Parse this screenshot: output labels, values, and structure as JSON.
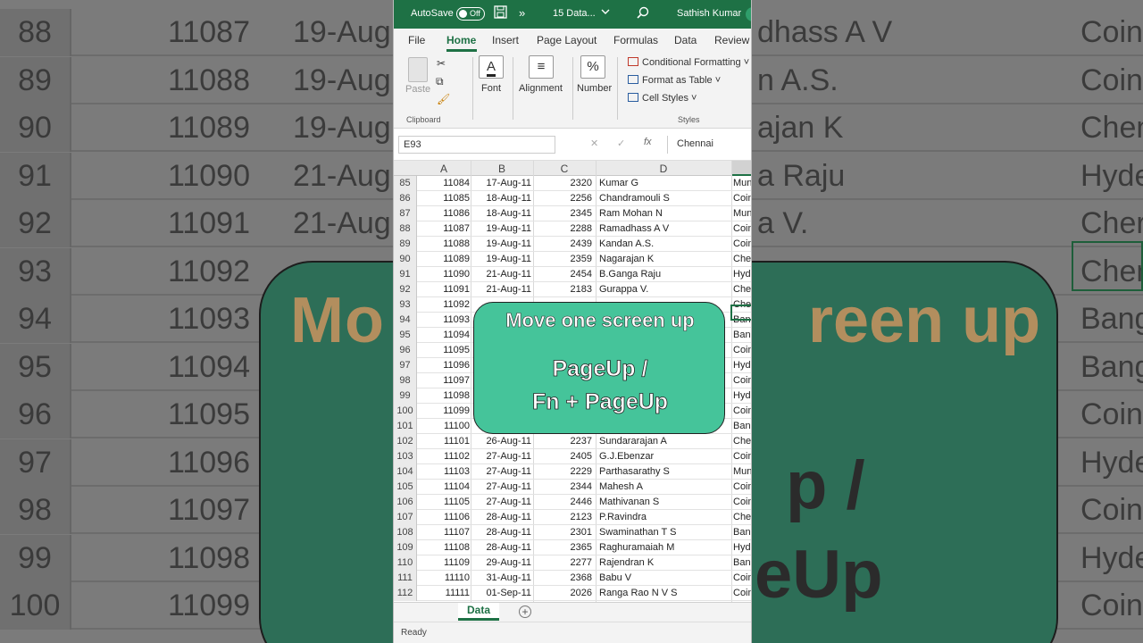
{
  "background": {
    "rows": [
      {
        "num": "88",
        "id": "11087",
        "date": "19-Aug",
        "name": "dhass A V",
        "city": "Coin"
      },
      {
        "num": "89",
        "id": "11088",
        "date": "19-Aug",
        "name": "n  A.S.",
        "city": "Coin"
      },
      {
        "num": "90",
        "id": "11089",
        "date": "19-Aug",
        "name": "ajan K",
        "city": "Chen"
      },
      {
        "num": "91",
        "id": "11090",
        "date": "21-Aug",
        "name": "a Raju",
        "city": "Hyde"
      },
      {
        "num": "92",
        "id": "11091",
        "date": "21-Aug",
        "name": "a V.",
        "city": "Cher"
      },
      {
        "num": "93",
        "id": "11092",
        "date": "",
        "name": "",
        "city": "Chen"
      },
      {
        "num": "94",
        "id": "11093",
        "date": "",
        "name": "",
        "city": "Bang"
      },
      {
        "num": "95",
        "id": "11094",
        "date": "",
        "name": "",
        "city": "Bang"
      },
      {
        "num": "96",
        "id": "11095",
        "date": "",
        "name": "",
        "city": "Coin"
      },
      {
        "num": "97",
        "id": "11096",
        "date": "",
        "name": "",
        "city": "Hyde"
      },
      {
        "num": "98",
        "id": "11097",
        "date": "",
        "name": "",
        "city": "Coin"
      },
      {
        "num": "99",
        "id": "11098",
        "date": "",
        "name": "",
        "city": "Hyde"
      },
      {
        "num": "100",
        "id": "11099",
        "date": "",
        "name": "",
        "city": "Coin"
      }
    ],
    "overlay_title": "Mo",
    "overlay_title_right": "reen up",
    "overlay_line_slash": "p /",
    "overlay_line_key": "eUp"
  },
  "titlebar": {
    "autosave_label": "AutoSave",
    "toggle_state": "Off",
    "more": "»",
    "filename": "15 Data...",
    "user": "Sathish Kumar"
  },
  "menu": [
    "File",
    "Home",
    "Insert",
    "Page Layout",
    "Formulas",
    "Data",
    "Review"
  ],
  "ribbon": {
    "paste": "Paste",
    "clipboard": "Clipboard",
    "font": "Font",
    "alignment": "Alignment",
    "number": "Number",
    "number_symbol": "%",
    "conditional_formatting": "Conditional Formatting",
    "format_as_table": "Format as Table",
    "cell_styles": "Cell Styles",
    "styles": "Styles"
  },
  "formula_bar": {
    "name_box": "E93",
    "value": "Chennai"
  },
  "columns": [
    "A",
    "B",
    "C",
    "D"
  ],
  "rows": [
    {
      "n": "85",
      "a": "11084",
      "b": "17-Aug-11",
      "c": "2320",
      "d": "Kumar G",
      "e": "Mun"
    },
    {
      "n": "86",
      "a": "11085",
      "b": "18-Aug-11",
      "c": "2256",
      "d": "Chandramouli S",
      "e": "Coin"
    },
    {
      "n": "87",
      "a": "11086",
      "b": "18-Aug-11",
      "c": "2345",
      "d": "Ram Mohan N",
      "e": "Mun"
    },
    {
      "n": "88",
      "a": "11087",
      "b": "19-Aug-11",
      "c": "2288",
      "d": "Ramadhass A V",
      "e": "Coin"
    },
    {
      "n": "89",
      "a": "11088",
      "b": "19-Aug-11",
      "c": "2439",
      "d": "Kandan  A.S.",
      "e": "Coin"
    },
    {
      "n": "90",
      "a": "11089",
      "b": "19-Aug-11",
      "c": "2359",
      "d": "Nagarajan K",
      "e": "Cher"
    },
    {
      "n": "91",
      "a": "11090",
      "b": "21-Aug-11",
      "c": "2454",
      "d": "B.Ganga Raju",
      "e": "Hyde"
    },
    {
      "n": "92",
      "a": "11091",
      "b": "21-Aug-11",
      "c": "2183",
      "d": "Gurappa  V.",
      "e": "Cher"
    },
    {
      "n": "93",
      "a": "11092",
      "b": "",
      "c": "",
      "d": "",
      "e": "Cher"
    },
    {
      "n": "94",
      "a": "11093",
      "b": "",
      "c": "",
      "d": "",
      "e": "Bang"
    },
    {
      "n": "95",
      "a": "11094",
      "b": "",
      "c": "",
      "d": "",
      "e": "Bang"
    },
    {
      "n": "96",
      "a": "11095",
      "b": "",
      "c": "",
      "d": "",
      "e": "Coin"
    },
    {
      "n": "97",
      "a": "11096",
      "b": "",
      "c": "",
      "d": "",
      "e": "Hyde"
    },
    {
      "n": "98",
      "a": "11097",
      "b": "",
      "c": "",
      "d": "",
      "e": "Coin"
    },
    {
      "n": "99",
      "a": "11098",
      "b": "",
      "c": "",
      "d": "",
      "e": "Hyde"
    },
    {
      "n": "100",
      "a": "11099",
      "b": "",
      "c": "",
      "d": "",
      "e": "Coin"
    },
    {
      "n": "101",
      "a": "11100",
      "b": "",
      "c": "",
      "d": "",
      "e": "Bang"
    },
    {
      "n": "102",
      "a": "11101",
      "b": "26-Aug-11",
      "c": "2237",
      "d": "Sundararajan A",
      "e": "Cher"
    },
    {
      "n": "103",
      "a": "11102",
      "b": "27-Aug-11",
      "c": "2405",
      "d": "G.J.Ebenzar",
      "e": "Coin"
    },
    {
      "n": "104",
      "a": "11103",
      "b": "27-Aug-11",
      "c": "2229",
      "d": "Parthasarathy S",
      "e": "Mun"
    },
    {
      "n": "105",
      "a": "11104",
      "b": "27-Aug-11",
      "c": "2344",
      "d": "Mahesh  A",
      "e": "Coin"
    },
    {
      "n": "106",
      "a": "11105",
      "b": "27-Aug-11",
      "c": "2446",
      "d": "Mathivanan S",
      "e": "Coin"
    },
    {
      "n": "107",
      "a": "11106",
      "b": "28-Aug-11",
      "c": "2123",
      "d": "P.Ravindra",
      "e": "Cher"
    },
    {
      "n": "108",
      "a": "11107",
      "b": "28-Aug-11",
      "c": "2301",
      "d": "Swaminathan T S",
      "e": "Bang"
    },
    {
      "n": "109",
      "a": "11108",
      "b": "28-Aug-11",
      "c": "2365",
      "d": "Raghuramaiah M",
      "e": "Hyde"
    },
    {
      "n": "110",
      "a": "11109",
      "b": "29-Aug-11",
      "c": "2277",
      "d": "Rajendran K",
      "e": "Bang"
    },
    {
      "n": "111",
      "a": "11110",
      "b": "31-Aug-11",
      "c": "2368",
      "d": "Babu V",
      "e": "Coin"
    },
    {
      "n": "112",
      "a": "11111",
      "b": "01-Sep-11",
      "c": "2026",
      "d": "Ranga Rao N V S",
      "e": "Coin"
    }
  ],
  "overlay": {
    "title": "Move one screen up",
    "line1": "PageUp /",
    "line2": "Fn + PageUp"
  },
  "sheet_tab": "Data",
  "add_sheet": "+",
  "status": "Ready",
  "colors": {
    "excel_green": "#1e7145",
    "card_green": "#45c49a"
  }
}
